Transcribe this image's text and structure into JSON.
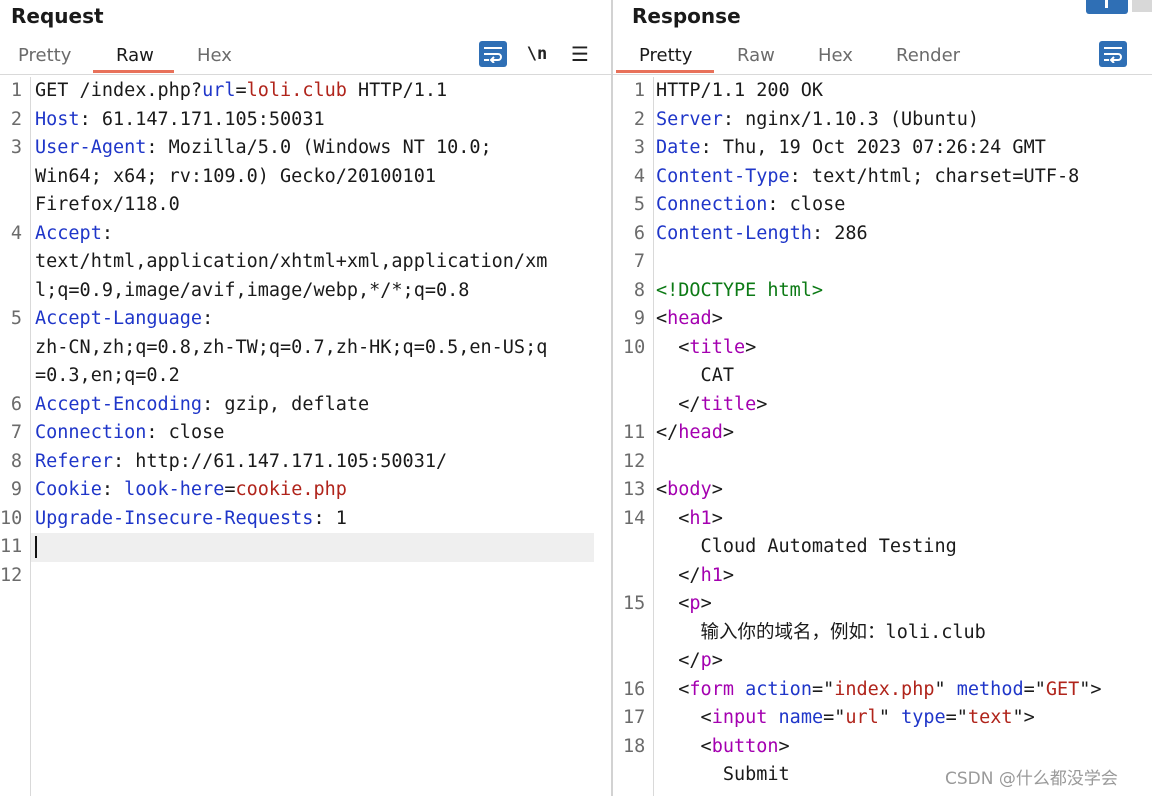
{
  "request": {
    "title": "Request",
    "tabs": [
      "Pretty",
      "Raw",
      "Hex"
    ],
    "active_tab": "Raw",
    "toolbar": {
      "newline_label": "\\n",
      "menu_glyph": "☰"
    },
    "lines": [
      {
        "n": "1",
        "parts": [
          {
            "t": "GET /index.php?"
          },
          {
            "t": "url",
            "c": "k"
          },
          {
            "t": "="
          },
          {
            "t": "loli.club",
            "c": "rv"
          },
          {
            "t": " HTTP/1.1"
          }
        ]
      },
      {
        "n": "2",
        "parts": [
          {
            "t": "Host",
            "c": "k"
          },
          {
            "t": ": 61.147.171.105:50031"
          }
        ]
      },
      {
        "n": "3",
        "parts": [
          {
            "t": "User-Agent",
            "c": "k"
          },
          {
            "t": ": Mozilla/5.0 (Windows NT 10.0;"
          }
        ]
      },
      {
        "n": "",
        "parts": [
          {
            "t": "Win64; x64; rv:109.0) Gecko/20100101"
          }
        ]
      },
      {
        "n": "",
        "parts": [
          {
            "t": "Firefox/118.0"
          }
        ]
      },
      {
        "n": "4",
        "parts": [
          {
            "t": "Accept",
            "c": "k"
          },
          {
            "t": ":"
          }
        ]
      },
      {
        "n": "",
        "parts": [
          {
            "t": "text/html,application/xhtml+xml,application/xm"
          }
        ]
      },
      {
        "n": "",
        "parts": [
          {
            "t": "l;q=0.9,image/avif,image/webp,*/*;q=0.8"
          }
        ]
      },
      {
        "n": "5",
        "parts": [
          {
            "t": "Accept-Language",
            "c": "k"
          },
          {
            "t": ":"
          }
        ]
      },
      {
        "n": "",
        "parts": [
          {
            "t": "zh-CN,zh;q=0.8,zh-TW;q=0.7,zh-HK;q=0.5,en-US;q"
          }
        ]
      },
      {
        "n": "",
        "parts": [
          {
            "t": "=0.3,en;q=0.2"
          }
        ]
      },
      {
        "n": "6",
        "parts": [
          {
            "t": "Accept-Encoding",
            "c": "k"
          },
          {
            "t": ": gzip, deflate"
          }
        ]
      },
      {
        "n": "7",
        "parts": [
          {
            "t": "Connection",
            "c": "k"
          },
          {
            "t": ": close"
          }
        ]
      },
      {
        "n": "8",
        "parts": [
          {
            "t": "Referer",
            "c": "k"
          },
          {
            "t": ": http://61.147.171.105:50031/"
          }
        ]
      },
      {
        "n": "9",
        "parts": [
          {
            "t": "Cookie",
            "c": "k"
          },
          {
            "t": ": "
          },
          {
            "t": "look-here",
            "c": "sv"
          },
          {
            "t": "="
          },
          {
            "t": "cookie.php",
            "c": "rv"
          }
        ]
      },
      {
        "n": "10",
        "parts": [
          {
            "t": "Upgrade-Insecure-Requests",
            "c": "k"
          },
          {
            "t": ": 1"
          }
        ]
      },
      {
        "n": "11",
        "parts": [],
        "current": true
      },
      {
        "n": "12",
        "parts": []
      }
    ]
  },
  "response": {
    "title": "Response",
    "tabs": [
      "Pretty",
      "Raw",
      "Hex",
      "Render"
    ],
    "active_tab": "Pretty",
    "lines": [
      {
        "n": "1",
        "parts": [
          {
            "t": "HTTP/1.1 200 OK"
          }
        ]
      },
      {
        "n": "2",
        "parts": [
          {
            "t": "Server",
            "c": "k"
          },
          {
            "t": ": nginx/1.10.3 (Ubuntu)"
          }
        ]
      },
      {
        "n": "3",
        "parts": [
          {
            "t": "Date",
            "c": "k"
          },
          {
            "t": ": Thu, 19 Oct 2023 07:26:24 GMT"
          }
        ]
      },
      {
        "n": "4",
        "parts": [
          {
            "t": "Content-Type",
            "c": "k"
          },
          {
            "t": ": text/html; charset=UTF-8"
          }
        ]
      },
      {
        "n": "5",
        "parts": [
          {
            "t": "Connection",
            "c": "k"
          },
          {
            "t": ": close"
          }
        ]
      },
      {
        "n": "6",
        "parts": [
          {
            "t": "Content-Length",
            "c": "k"
          },
          {
            "t": ": 286"
          }
        ]
      },
      {
        "n": "7",
        "parts": []
      },
      {
        "n": "8",
        "parts": [
          {
            "t": "<!DOCTYPE html>",
            "c": "dt"
          }
        ]
      },
      {
        "n": "9",
        "parts": [
          {
            "t": "<"
          },
          {
            "t": "head",
            "c": "tg"
          },
          {
            "t": ">"
          }
        ]
      },
      {
        "n": "10",
        "parts": [
          {
            "t": "  <"
          },
          {
            "t": "title",
            "c": "tg"
          },
          {
            "t": ">"
          }
        ]
      },
      {
        "n": "",
        "parts": [
          {
            "t": "    CAT"
          }
        ]
      },
      {
        "n": "",
        "parts": [
          {
            "t": "  </"
          },
          {
            "t": "title",
            "c": "tg"
          },
          {
            "t": ">"
          }
        ]
      },
      {
        "n": "11",
        "parts": [
          {
            "t": "</"
          },
          {
            "t": "head",
            "c": "tg"
          },
          {
            "t": ">"
          }
        ]
      },
      {
        "n": "12",
        "parts": []
      },
      {
        "n": "13",
        "parts": [
          {
            "t": "<"
          },
          {
            "t": "body",
            "c": "tg"
          },
          {
            "t": ">"
          }
        ]
      },
      {
        "n": "14",
        "parts": [
          {
            "t": "  <"
          },
          {
            "t": "h1",
            "c": "tg"
          },
          {
            "t": ">"
          }
        ]
      },
      {
        "n": "",
        "parts": [
          {
            "t": "    Cloud Automated Testing"
          }
        ]
      },
      {
        "n": "",
        "parts": [
          {
            "t": "  </"
          },
          {
            "t": "h1",
            "c": "tg"
          },
          {
            "t": ">"
          }
        ]
      },
      {
        "n": "15",
        "parts": [
          {
            "t": "  <"
          },
          {
            "t": "p",
            "c": "tg"
          },
          {
            "t": ">"
          }
        ]
      },
      {
        "n": "",
        "parts": [
          {
            "t": "    输入你的域名，例如：loli.club"
          }
        ]
      },
      {
        "n": "",
        "parts": [
          {
            "t": "  </"
          },
          {
            "t": "p",
            "c": "tg"
          },
          {
            "t": ">"
          }
        ]
      },
      {
        "n": "16",
        "parts": [
          {
            "t": "  <"
          },
          {
            "t": "form",
            "c": "tg"
          },
          {
            "t": " "
          },
          {
            "t": "action",
            "c": "at"
          },
          {
            "t": "=\""
          },
          {
            "t": "index.php",
            "c": "rv"
          },
          {
            "t": "\" "
          },
          {
            "t": "method",
            "c": "at"
          },
          {
            "t": "=\""
          },
          {
            "t": "GET",
            "c": "rv"
          },
          {
            "t": "\">"
          }
        ]
      },
      {
        "n": "17",
        "parts": [
          {
            "t": "    <"
          },
          {
            "t": "input",
            "c": "tg"
          },
          {
            "t": " "
          },
          {
            "t": "name",
            "c": "at"
          },
          {
            "t": "=\""
          },
          {
            "t": "url",
            "c": "rv"
          },
          {
            "t": "\" "
          },
          {
            "t": "type",
            "c": "at"
          },
          {
            "t": "=\""
          },
          {
            "t": "text",
            "c": "rv"
          },
          {
            "t": "\">"
          }
        ]
      },
      {
        "n": "18",
        "parts": [
          {
            "t": "    <"
          },
          {
            "t": "button",
            "c": "tg"
          },
          {
            "t": ">"
          }
        ]
      },
      {
        "n": "",
        "parts": [
          {
            "t": "      Submit"
          }
        ]
      }
    ]
  },
  "watermark": "CSDN @什么都没学会",
  "colors": {
    "key": "#1f36c9",
    "value_red": "#b0241b",
    "tag_purple": "#a400b0",
    "doctype_green": "#0c7a15",
    "tab_underline": "#e8715a",
    "toolbar_blue": "#2f6fb5"
  }
}
